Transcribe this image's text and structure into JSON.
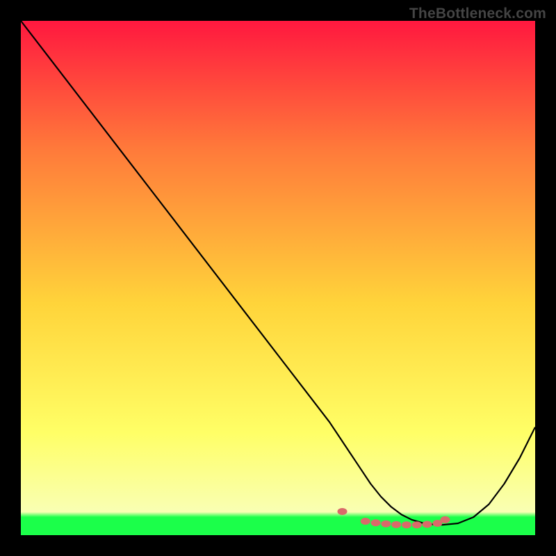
{
  "watermark": "TheBottleneck.com",
  "chart_data": {
    "type": "line",
    "title": "",
    "xlabel": "",
    "ylabel": "",
    "xlim": [
      0,
      100
    ],
    "ylim": [
      0,
      100
    ],
    "grid": false,
    "background_gradient": {
      "top": "#ff183f",
      "mid_upper": "#ff7a3a",
      "mid": "#ffd43a",
      "mid_lower": "#ffff66",
      "bottom_band": "#f9ffb3",
      "green": "#1bff4a"
    },
    "series": [
      {
        "name": "curve",
        "color": "#000000",
        "x": [
          0,
          5,
          10,
          15,
          20,
          25,
          30,
          35,
          40,
          45,
          50,
          55,
          60,
          62,
          64,
          66,
          68,
          70,
          72,
          74,
          76,
          78,
          80,
          82,
          85,
          88,
          91,
          94,
          97,
          100
        ],
        "y": [
          100,
          93.5,
          87,
          80.5,
          74,
          67.5,
          61,
          54.5,
          48,
          41.5,
          35,
          28.5,
          22,
          19,
          16,
          13,
          10,
          7.5,
          5.5,
          4.0,
          3.0,
          2.4,
          2.1,
          2.0,
          2.3,
          3.5,
          6.0,
          10.0,
          15.0,
          21.0
        ]
      },
      {
        "name": "minimum-dots",
        "color": "#d96a6a",
        "type": "scatter",
        "x": [
          62.5,
          67,
          69,
          71,
          73,
          75,
          77,
          79,
          81,
          82.5
        ],
        "y": [
          4.6,
          2.7,
          2.4,
          2.2,
          2.05,
          2.0,
          2.0,
          2.1,
          2.3,
          3.0
        ]
      }
    ]
  }
}
